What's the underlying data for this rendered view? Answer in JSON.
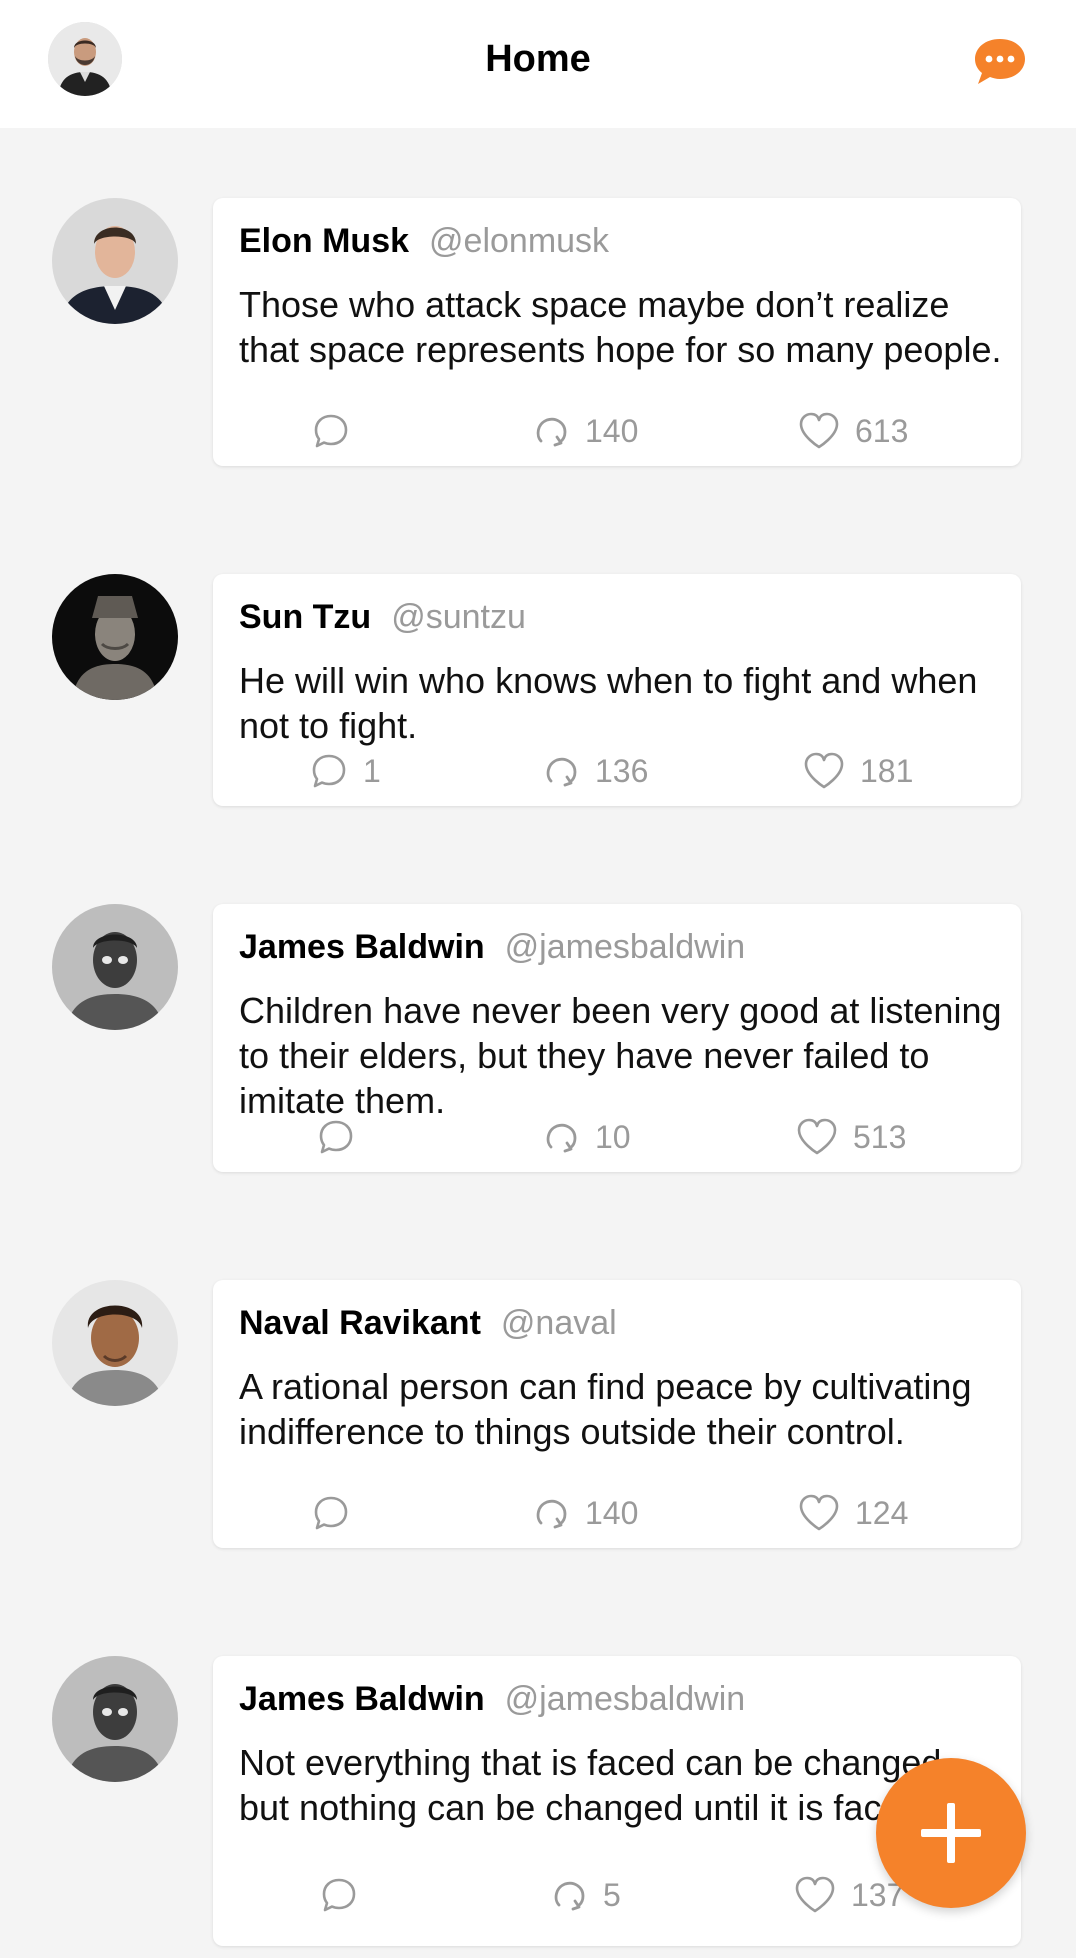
{
  "header": {
    "title": "Home",
    "accent": "#f5822a"
  },
  "posts": [
    {
      "name": "Elon Musk",
      "handle": "@elonmusk",
      "text": "Those who attack space maybe don’t realize that space represents hope for so many people.",
      "replies": "",
      "retweets": "140",
      "likes": "613"
    },
    {
      "name": "Sun Tzu",
      "handle": "@suntzu",
      "text": "He will win who knows when to fight and when not to fight.",
      "replies": "1",
      "retweets": "136",
      "likes": "181"
    },
    {
      "name": "James Baldwin",
      "handle": "@jamesbaldwin",
      "text": "Children have never been very good at listening to their elders, but they have never failed to imitate them.",
      "replies": "",
      "retweets": "10",
      "likes": "513"
    },
    {
      "name": "Naval Ravikant",
      "handle": "@naval",
      "text": "A rational person can find peace by cultivating indifference to things outside their control.",
      "replies": "",
      "retweets": "140",
      "likes": "124"
    },
    {
      "name": "James Baldwin",
      "handle": "@jamesbaldwin",
      "text": "Not everything that is faced can be changed, but nothing can be changed until it is faced.",
      "replies": "",
      "retweets": "5",
      "likes": "137"
    }
  ]
}
